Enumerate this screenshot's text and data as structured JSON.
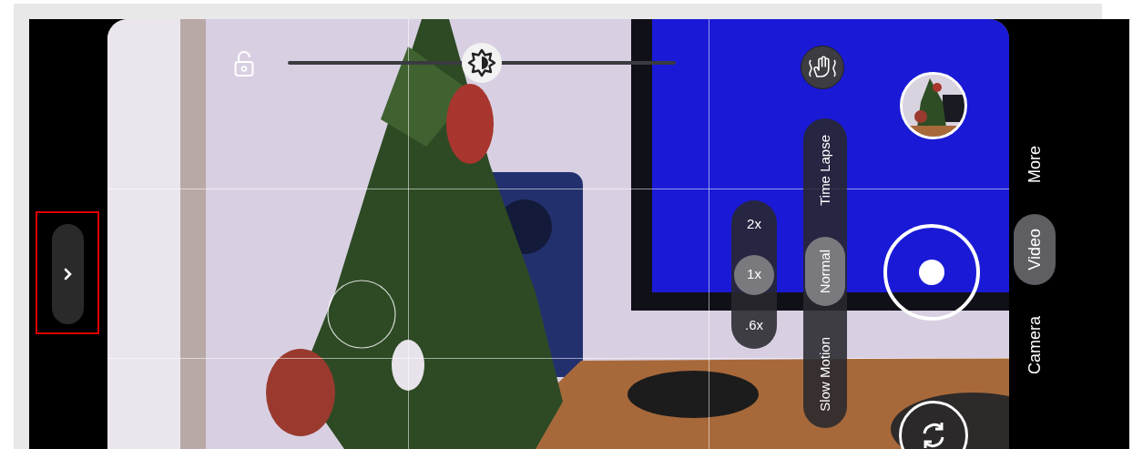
{
  "exposure": {
    "level": 0.5
  },
  "zoom_levels": [
    {
      "label": "2x",
      "selected": false
    },
    {
      "label": "1x",
      "selected": true
    },
    {
      "label": ".6x",
      "selected": false
    }
  ],
  "video_modes": [
    {
      "label": "Time Lapse",
      "selected": false
    },
    {
      "label": "Normal",
      "selected": true
    },
    {
      "label": "Slow Motion",
      "selected": false
    }
  ],
  "camera_modes": [
    {
      "label": "More",
      "selected": false
    },
    {
      "label": "Video",
      "selected": true
    },
    {
      "label": "Camera",
      "selected": false
    }
  ]
}
